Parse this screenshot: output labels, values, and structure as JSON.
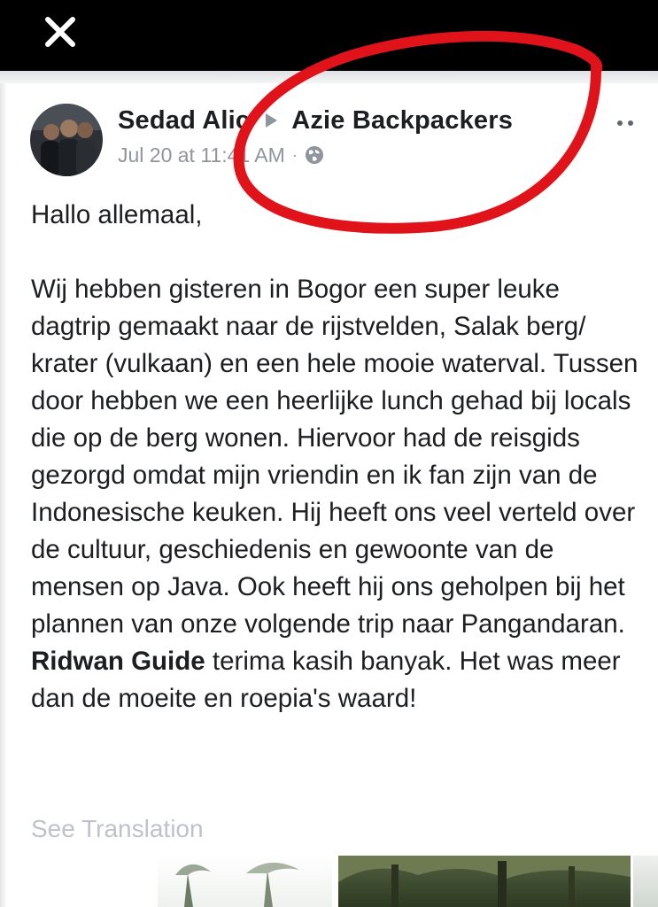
{
  "viewer": {
    "close_label": "close"
  },
  "post": {
    "author": "Sedad Alic",
    "group": "Azie Backpackers",
    "timestamp": "Jul 20 at 11:41 AM",
    "separator": "·",
    "privacy_icon": "globe-icon",
    "paragraphs": {
      "greeting": "Hallo allemaal,",
      "main": "Wij hebben gisteren in Bogor een super leuke dagtrip gemaakt naar de rijstvelden, Salak berg/ krater (vulkaan) en een hele mooie waterval. Tussen door hebben we een heerlijke lunch gehad bij locals die op de berg wonen. Hiervoor had de reisgids gezorgd omdat mijn vriendin en ik fan zijn van de Indonesische keuken. Hij heeft ons veel verteld over de cultuur, geschiedenis en gewoonte van de mensen op Java. Ook heeft hij ons geholpen bij het plannen van onze volgende trip naar Pangandaran.",
      "mention": "Ridwan Guide",
      "tail": "terima kasih banyak. Het was meer dan de moeite en roepia's waard!"
    },
    "see_translation": "See Translation"
  },
  "colors": {
    "annotation_circle": "#e0121a",
    "meta_gray": "#90949c",
    "text": "#1c1e21"
  }
}
